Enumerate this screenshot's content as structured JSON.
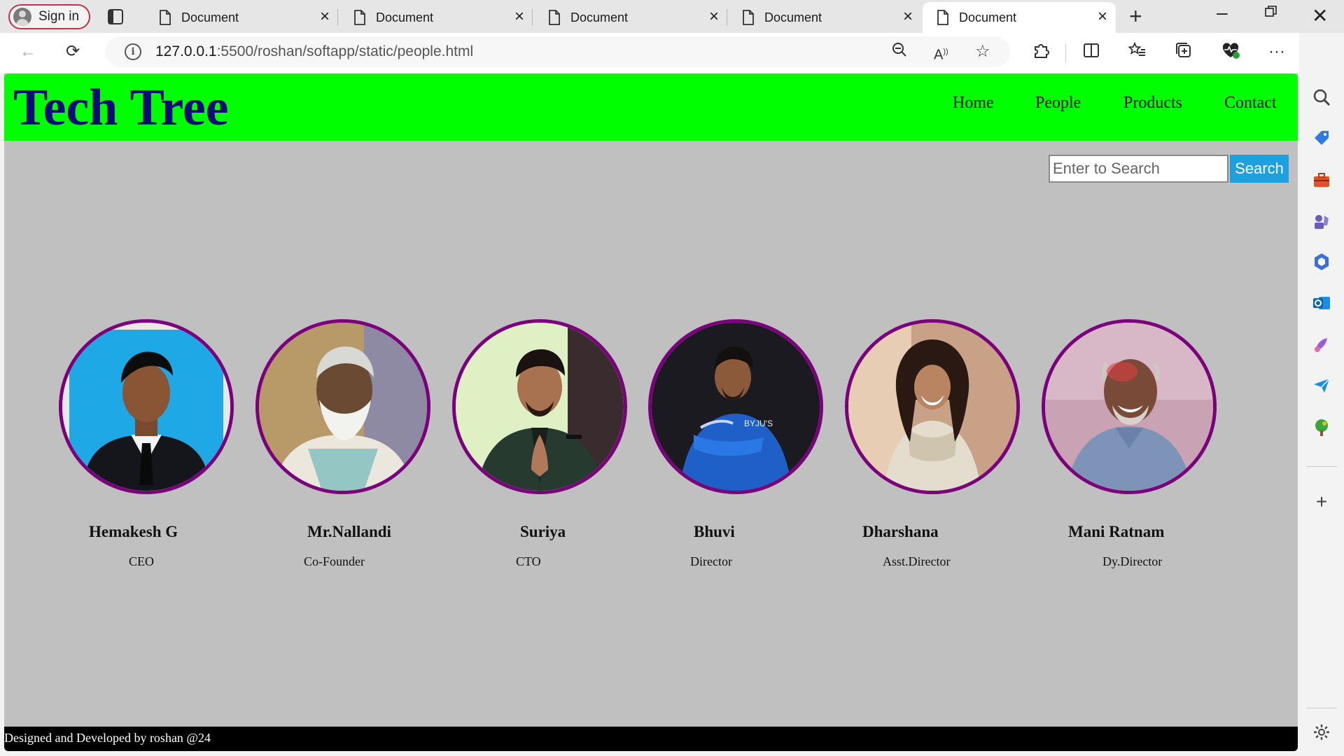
{
  "browser": {
    "signin_label": "Sign in",
    "tabs": [
      {
        "title": "Document"
      },
      {
        "title": "Document"
      },
      {
        "title": "Document"
      },
      {
        "title": "Document"
      },
      {
        "title": "Document",
        "active": true
      }
    ],
    "url_host": "127.0.0.1",
    "url_path": ":5500/roshan/softapp/static/people.html"
  },
  "site": {
    "brand": "Tech Tree",
    "nav": [
      "Home",
      "People",
      "Products",
      "Contact"
    ],
    "search": {
      "placeholder": "Enter to Search",
      "button": "Search"
    },
    "people": [
      {
        "name": "Hemakesh G",
        "role": "CEO"
      },
      {
        "name": "Mr.Nallandi",
        "role": "Co-Founder"
      },
      {
        "name": "Suriya",
        "role": "CTO"
      },
      {
        "name": "Bhuvi",
        "role": "Director"
      },
      {
        "name": "Dharshana",
        "role": "Asst.Director"
      },
      {
        "name": "Mani Ratnam",
        "role": "Dy.Director"
      }
    ],
    "footer": "Designed and Developed by roshan @24"
  },
  "colors": {
    "header_bg": "#00ff00",
    "brand_text": "#0b0b7a",
    "page_bg": "#c0c0c0",
    "photo_border": "#7b007b",
    "search_button": "#1e9fe0",
    "footer_bg": "#000000"
  }
}
